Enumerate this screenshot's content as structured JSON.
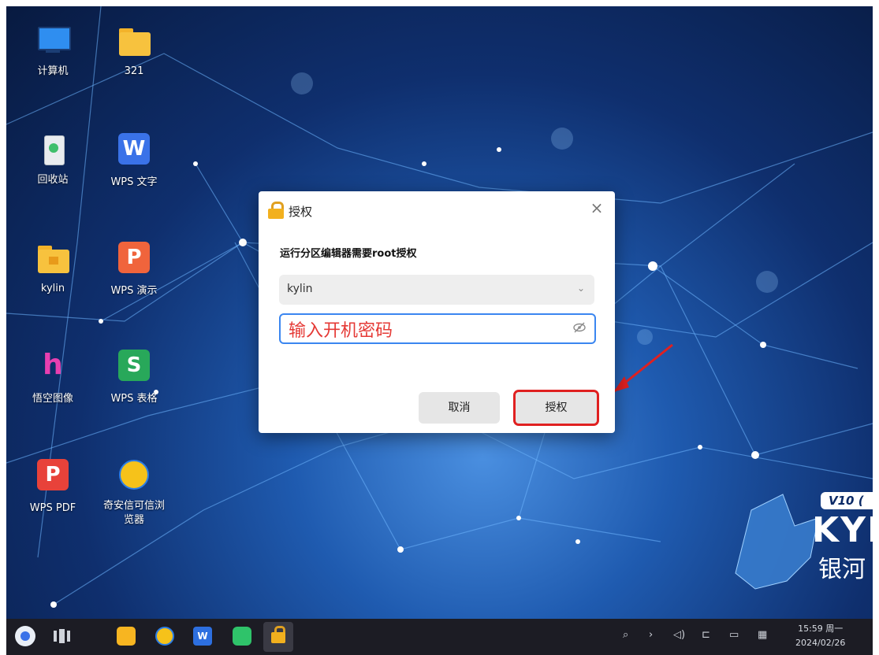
{
  "desktop": {
    "icons": [
      {
        "label": "计算机",
        "icon": "computer-icon"
      },
      {
        "label": "321",
        "icon": "folder-icon"
      },
      {
        "label": "回收站",
        "icon": "trash-icon"
      },
      {
        "label": "WPS 文字",
        "icon": "wps-writer-icon"
      },
      {
        "label": "kylin",
        "icon": "home-folder-icon"
      },
      {
        "label": "WPS 演示",
        "icon": "wps-presentation-icon"
      },
      {
        "label": "悟空图像",
        "icon": "wukong-image-icon"
      },
      {
        "label": "WPS 表格",
        "icon": "wps-spreadsheet-icon"
      },
      {
        "label": "WPS PDF",
        "icon": "wps-pdf-icon"
      },
      {
        "label": "奇安信可信浏览器",
        "icon": "qianxin-browser-icon"
      }
    ],
    "brand": {
      "version": "V10 (",
      "name": "KYL",
      "cn": "银河"
    }
  },
  "dialog": {
    "title": "授权",
    "message": "运行分区编辑器需要root授权",
    "user": "kylin",
    "password_placeholder": "输入开机密码",
    "cancel": "取消",
    "authorize": "授权"
  },
  "taskbar": {
    "time": "15:59 周一",
    "date": "2024/02/26"
  },
  "colors": {
    "accent": "#3b86f0",
    "highlight": "#e02020",
    "taskbar": "#1c1c24"
  }
}
